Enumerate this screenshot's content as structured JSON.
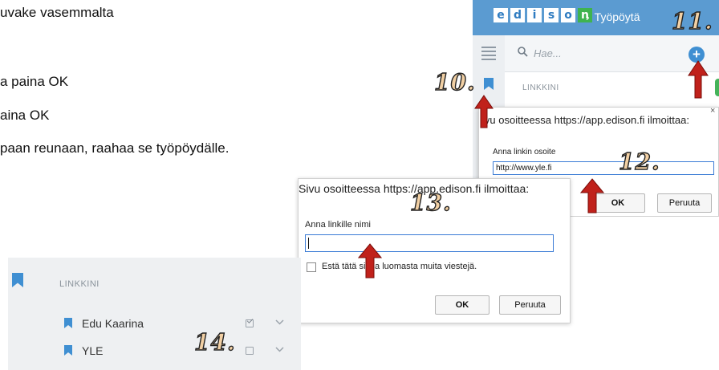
{
  "instructions": [
    "uvake vasemmalta",
    "a paina OK",
    "aina OK",
    "paan reunaan, raahaa se työpöydälle."
  ],
  "app": {
    "logo_letters": [
      "e",
      "d",
      "i",
      "s",
      "o",
      "n"
    ],
    "breadcrumb_sep": "›",
    "breadcrumb": "Työpöytä",
    "search_placeholder": "Hae...",
    "add_button": "+",
    "section_label": "LINKKINI",
    "brand_color": "#5b9bd1"
  },
  "dialog_url": {
    "title": "ivu osoitteessa https://app.edison.fi ilmoittaa:",
    "close": "×",
    "field_label": "Anna linkin osoite",
    "field_value": "http://www.yle.fi",
    "paren": ")",
    "ok": "OK",
    "cancel": "Peruuta"
  },
  "dialog_name": {
    "title": "Sivu osoitteessa https://app.edison.fi ilmoittaa:",
    "field_label": "Anna linkille nimi",
    "field_value": "",
    "checkbox_label": "Estä tätä sivua luomasta muita viestejä.",
    "checkbox_checked": false,
    "ok": "OK",
    "cancel": "Peruuta"
  },
  "link_panel": {
    "section_label": "LINKKINI",
    "items": [
      {
        "label": "Edu Kaarina",
        "checked": true
      },
      {
        "label": "YLE",
        "checked": false
      }
    ]
  },
  "steps": [
    "10.",
    "11.",
    "12.",
    "13.",
    "14."
  ],
  "colors": {
    "accent": "#3f8fd2",
    "bookmark": "#3f8fd2",
    "arrow": "#c0211b",
    "step_fill": "#f2d0a4"
  }
}
